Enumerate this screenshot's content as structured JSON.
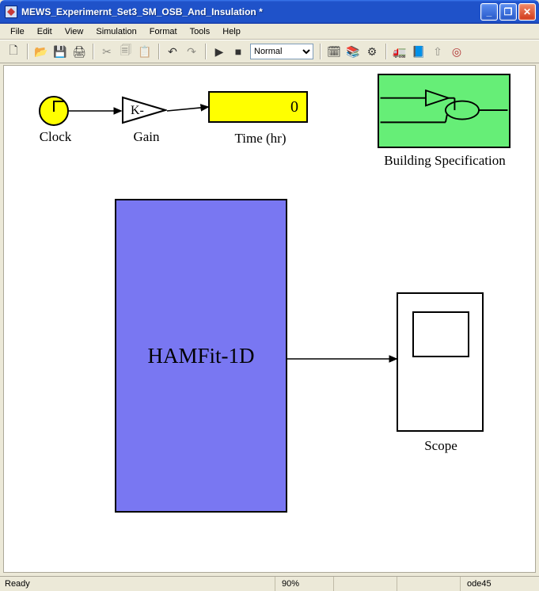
{
  "window": {
    "title": "MEWS_Experimernt_Set3_SM_OSB_And_Insulation *"
  },
  "menu": {
    "file": "File",
    "edit": "Edit",
    "view": "View",
    "simulation": "Simulation",
    "format": "Format",
    "tools": "Tools",
    "help": "Help"
  },
  "toolbar": {
    "mode": "Normal"
  },
  "diagram": {
    "clock_label": "Clock",
    "gain_label": "Gain",
    "gain_value": "K-",
    "display_value": "0",
    "display_label": "Time (hr)",
    "spec_label": "Building Specification",
    "ham_label": "HAMFit-1D",
    "scope_label": "Scope"
  },
  "status": {
    "ready": "Ready",
    "zoom": "90%",
    "solver": "ode45"
  },
  "icons": {
    "new": "🗋",
    "open": "📂",
    "save": "💾",
    "print": "🖨",
    "cut": "✂",
    "copy": "🗐",
    "paste": "📋",
    "undo": "↶",
    "redo": "↷",
    "play": "▶",
    "stop": "■",
    "build": "🗓",
    "layers": "📚",
    "gear": "⚙",
    "lib": "📘",
    "refresh": "⟳",
    "up": "⇧",
    "target": "◎",
    "truck": "🚛"
  }
}
